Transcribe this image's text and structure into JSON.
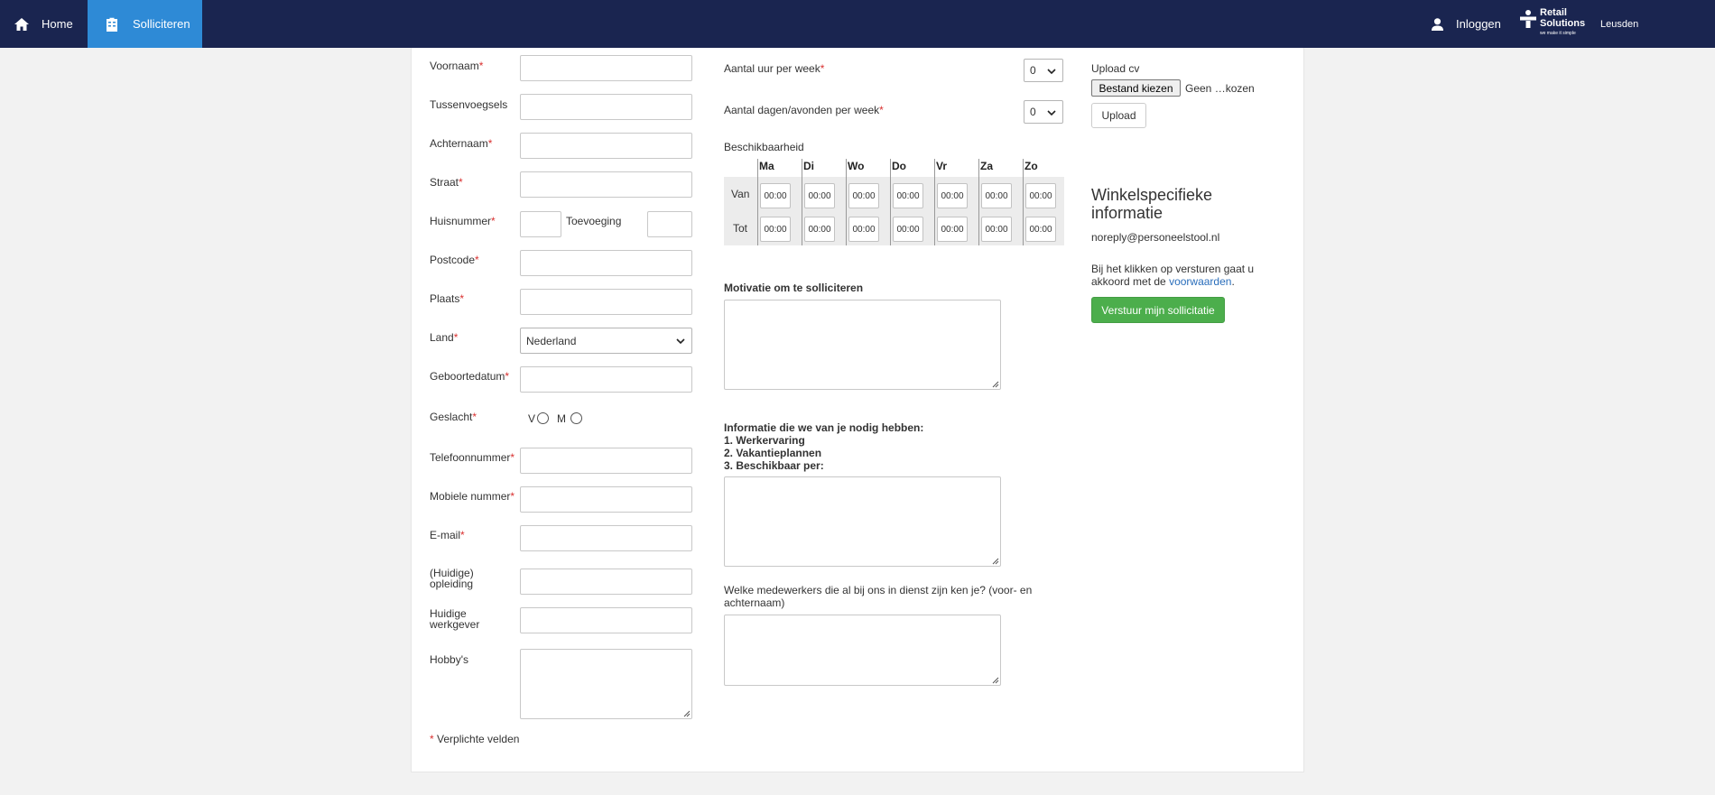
{
  "nav": {
    "home_label": "Home",
    "apply_label": "Solliciteren",
    "login_label": "Inloggen",
    "brand_line1": "Retail",
    "brand_line2": "Solutions",
    "brand_tagline": "we make it simple",
    "store_name": "Leusden"
  },
  "colors": {
    "navbar": "#1a2550",
    "active_tab": "#2e8ad6",
    "required": "#d9302f",
    "submit": "#4cae4c",
    "link": "#2a6ebb"
  },
  "required_marker": "*",
  "personal": {
    "first_name_label": "Voornaam",
    "infix_label": "Tussenvoegsels",
    "last_name_label": "Achternaam",
    "street_label": "Straat",
    "house_number_label": "Huisnummer",
    "addition_label": "Toevoeging",
    "postcode_label": "Postcode",
    "city_label": "Plaats",
    "country_label": "Land",
    "country_value": "Nederland",
    "birthdate_label": "Geboortedatum",
    "gender_label": "Geslacht",
    "gender_option_f": "V",
    "gender_option_m": "M",
    "phone_label": "Telefoonnummer",
    "mobile_label": "Mobiele nummer",
    "email_label": "E-mail",
    "education_label_1": "(Huidige)",
    "education_label_2": "opleiding",
    "employer_label_1": "Huidige",
    "employer_label_2": "werkgever",
    "hobbies_label": "Hobby's",
    "required_note": "Verplichte velden"
  },
  "availability": {
    "hours_label": "Aantal uur per week",
    "hours_value": "0",
    "days_label": "Aantal dagen/avonden per week",
    "days_value": "0",
    "availability_label": "Beschikbaarheid",
    "days": [
      "Ma",
      "Di",
      "Wo",
      "Do",
      "Vr",
      "Za",
      "Zo"
    ],
    "from_label": "Van",
    "to_label": "Tot",
    "time_value": "00:00"
  },
  "motivation": {
    "motivation_label": "Motivatie om te solliciteren",
    "info_title": "Informatie die we van je nodig hebben:",
    "info_items": [
      "1. Werkervaring",
      "2. Vakantieplannen",
      "3. Beschikbaar per:"
    ],
    "colleagues_label_1": "Welke medewerkers die al bij ons in dienst zijn ken je? (voor- en",
    "colleagues_label_2": "achternaam)"
  },
  "upload": {
    "title": "Upload cv",
    "choose_file": "Bestand kiezen",
    "no_file": "Geen …kozen",
    "upload_button": "Upload"
  },
  "store_info": {
    "heading_1": "Winkelspecifieke",
    "heading_2": "informatie",
    "email": "noreply@personeelstool.nl",
    "terms_1": "Bij het klikken op versturen gaat u",
    "terms_2": "akkoord met de",
    "terms_link": "voorwaarden",
    "terms_end": ".",
    "submit_label": "Verstuur mijn sollicitatie"
  }
}
